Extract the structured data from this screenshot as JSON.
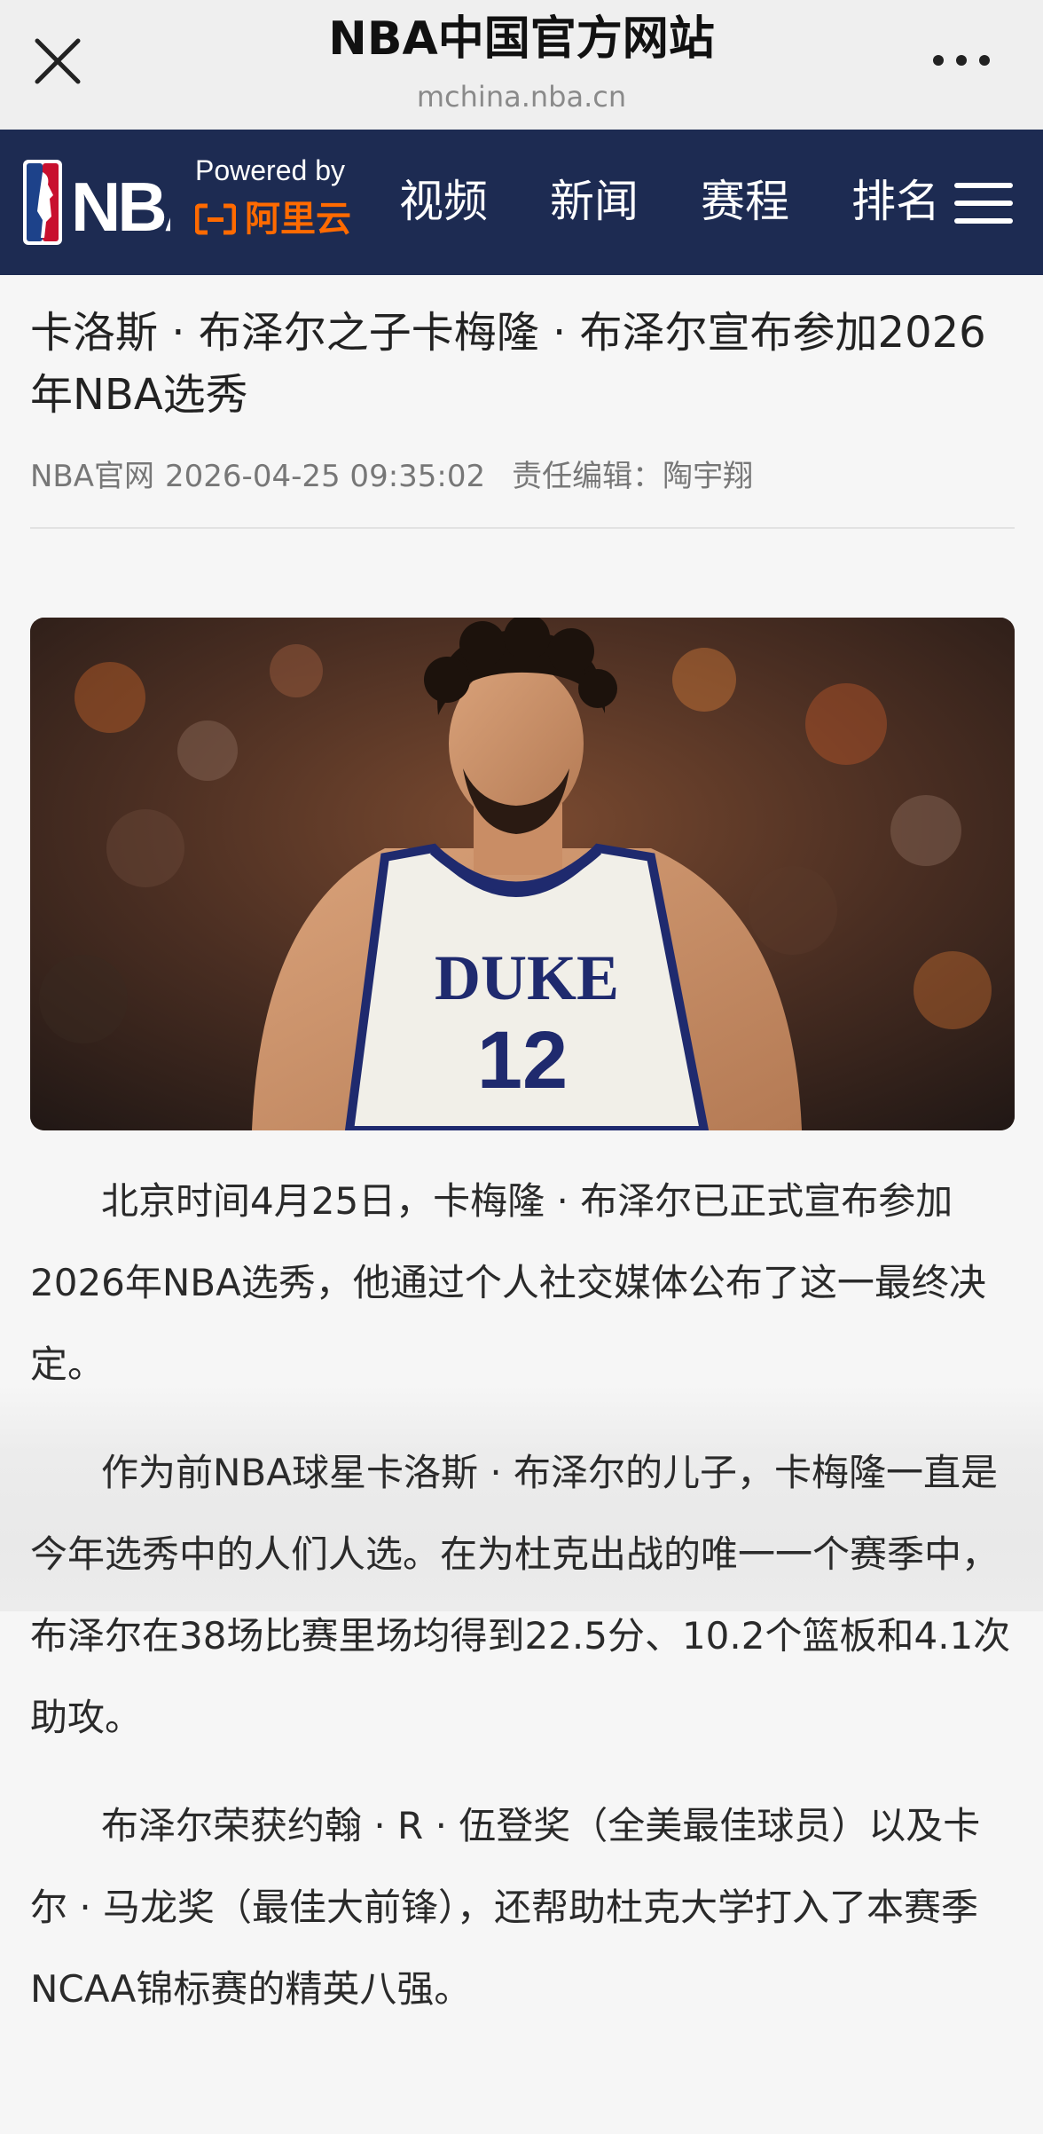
{
  "browser": {
    "title": "NBA中国官方网站",
    "url": "mchina.nba.cn",
    "close_icon": "close-icon",
    "more_icon": "more-dots-icon"
  },
  "nav": {
    "logo": "NBA",
    "powered_by": "Powered by",
    "sponsor": "阿里云",
    "items": [
      "视频",
      "新闻",
      "赛程",
      "排名"
    ],
    "menu_icon": "hamburger-menu-icon"
  },
  "article": {
    "headline": "卡洛斯 · 布泽尔之子卡梅隆 · 布泽尔宣布参加2026年NBA选秀",
    "source": "NBA官网",
    "datetime": "2026-04-25 09:35:02",
    "editor": "责任编辑：陶宇翔",
    "photo": {
      "jersey_team": "DUKE",
      "jersey_number": "12"
    },
    "paragraphs": [
      "北京时间4月25日，卡梅隆 · 布泽尔已正式宣布参加2026年NBA选秀，他通过个人社交媒体公布了这一最终决定。",
      "作为前NBA球星卡洛斯 · 布泽尔的儿子，卡梅隆一直是今年选秀中的人们人选。在为杜克出战的唯一一个赛季中，布泽尔在38场比赛里场均得到22.5分、10.2个篮板和4.1次助攻。",
      "布泽尔荣获约翰 · R · 伍登奖（全美最佳球员）以及卡尔 · 马龙奖（最佳大前锋），还帮助杜克大学打入了本赛季NCAA锦标赛的精英八强。"
    ]
  },
  "colors": {
    "nav_bg": "#1d2b52",
    "aliyun_orange": "#ff6a00",
    "duke_blue": "#1f2a6e"
  }
}
